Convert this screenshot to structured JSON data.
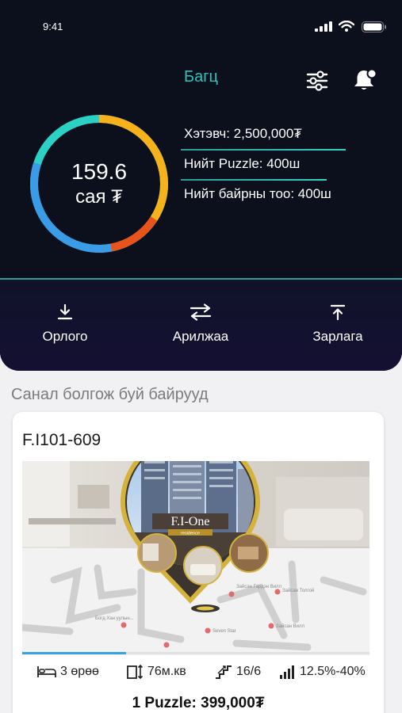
{
  "status_bar": {
    "time": "9:41"
  },
  "header": {
    "title": "Багц",
    "balance": {
      "value": "159.6",
      "unit": "сая ₮"
    },
    "stats": [
      {
        "label": "Хэтэвч: 2,500,000₮"
      },
      {
        "label": "Нийт Puzzle:  400ш"
      },
      {
        "label": "Нийт байрны тоо: 400ш"
      }
    ],
    "ring_colors": [
      "#f6b21b",
      "#e8531c",
      "#3a9be6",
      "#2bd1c5"
    ]
  },
  "actions": [
    {
      "label": "Орлого",
      "icon": "download-icon"
    },
    {
      "label": "Арилжаа",
      "icon": "swap-arrows-icon"
    },
    {
      "label": "Зарлага",
      "icon": "upload-icon"
    }
  ],
  "section": {
    "title": "Санал болгож буй байрууд"
  },
  "listing": {
    "code": "F.I101-609",
    "project_name": "F.I-One",
    "project_subtitle": "residence",
    "progress_fraction": 0.3,
    "specs": [
      {
        "icon": "bed-icon",
        "value": "3 өрөө"
      },
      {
        "icon": "area-icon",
        "value": "76м.кв"
      },
      {
        "icon": "stairs-icon",
        "value": "16/6"
      },
      {
        "icon": "signal-bars-icon",
        "value": "12.5%-40%"
      }
    ],
    "price": "1 Puzzle:  399,000₮",
    "map_labels": [
      "Зайсан Толгой",
      "Зайсан Гардэн Вилл",
      "Seven Star",
      "Богд Хан уулын...",
      "Зайсан Вилл"
    ]
  },
  "colors": {
    "accent": "#27c7bf",
    "header_bg": "#0c0f1c"
  }
}
